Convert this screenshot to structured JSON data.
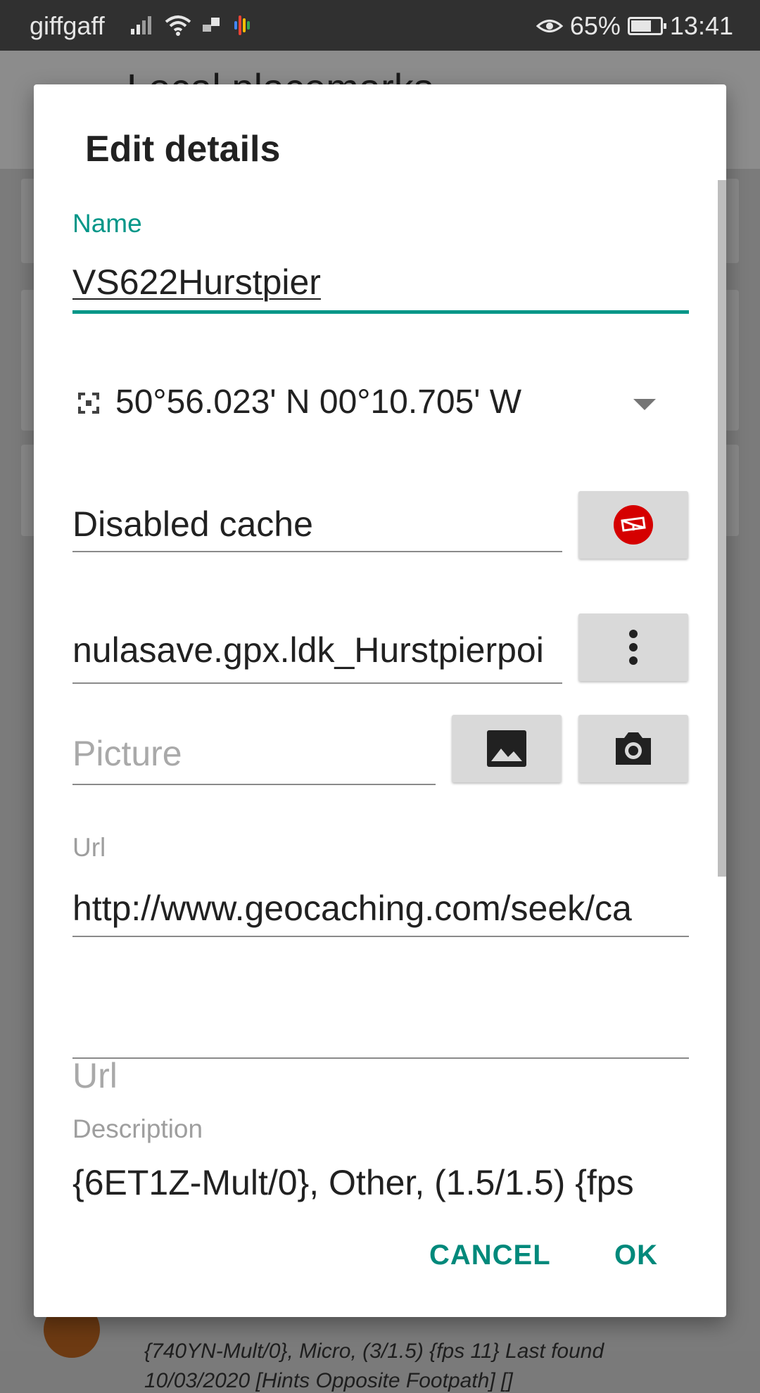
{
  "status_bar": {
    "carrier": "giffgaff",
    "battery": "65%",
    "time": "13:41"
  },
  "background": {
    "toolbar_title": "Local placemarks",
    "list_text_1": "{740YN-Mult/0}, Micro, (3/1.5) {fps 11} Last found",
    "list_text_2": "10/03/2020 [Hints Opposite Footpath] []"
  },
  "dialog": {
    "title": "Edit details",
    "name": {
      "label": "Name",
      "value": "VS622Hurstpier"
    },
    "coordinates": {
      "value": "50°56.023' N 00°10.705' W"
    },
    "cache_type": {
      "value": "Disabled cache",
      "icon": "cache-type-icon",
      "accent": "#d50000"
    },
    "file": {
      "value": "nulasave.gpx.ldk_Hurstpierpoi",
      "more_icon": "more-vert-icon"
    },
    "picture": {
      "placeholder": "Picture",
      "gallery_icon": "image-icon",
      "camera_icon": "camera-icon"
    },
    "url1": {
      "label": "Url",
      "value": "http://www.geocaching.com/seek/ca"
    },
    "url2": {
      "placeholder": "Url"
    },
    "description": {
      "label": "Description",
      "value": "{6ET1Z-Mult/0}, Other, (1.5/1.5) {fps"
    },
    "buttons": {
      "cancel": "CANCEL",
      "ok": "OK"
    }
  },
  "colors": {
    "accent": "#009688",
    "button_text": "#00897b",
    "status_bar": "#303030"
  }
}
